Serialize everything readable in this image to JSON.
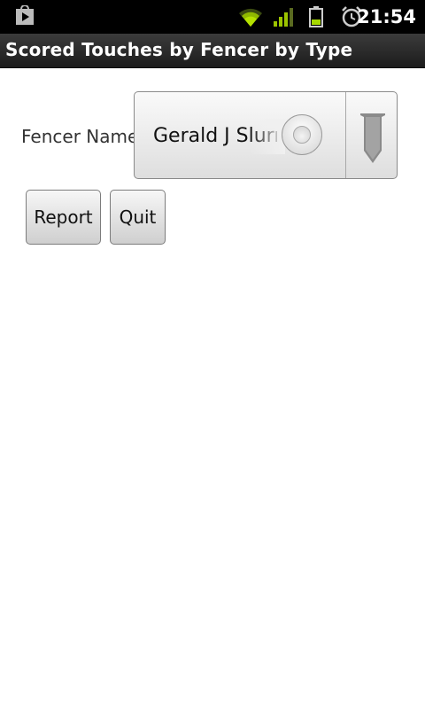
{
  "status_bar": {
    "time": "21:54",
    "icons": [
      "play-store-icon",
      "wifi-icon",
      "signal-icon",
      "battery-icon",
      "alarm-icon"
    ]
  },
  "title_bar": {
    "title": "Scored Touches by Fencer by Type"
  },
  "form": {
    "fencer_label": "Fencer Name",
    "fencer_selected": "Gerald J Slurr"
  },
  "buttons": {
    "report": "Report",
    "quit": "Quit"
  },
  "colors": {
    "status_bar_bg": "#000000",
    "title_bar_bg": "#2a2a2a",
    "background": "#ffffff",
    "wifi": "#b4e000",
    "battery": "#a6d800"
  }
}
